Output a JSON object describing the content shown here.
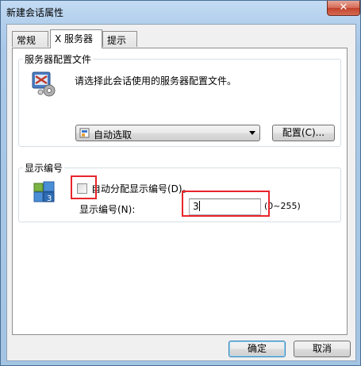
{
  "window": {
    "title": "新建会话属性",
    "close_glyph": "✕"
  },
  "tabs": [
    {
      "label": "常规"
    },
    {
      "label": "X 服务器"
    },
    {
      "label": "提示"
    }
  ],
  "server_config": {
    "group_label": "服务器配置文件",
    "description": "请选择此会话使用的服务器配置文件。",
    "selected": "自动选取",
    "config_button": "配置(C)..."
  },
  "display_number": {
    "group_label": "显示编号",
    "auto_assign_label": "自动分配显示编号(D)。",
    "auto_assign_checked": false,
    "field_label": "显示编号(N):",
    "value": "3",
    "range_hint": "(0~255)"
  },
  "footer": {
    "ok": "确定",
    "cancel": "取消"
  }
}
